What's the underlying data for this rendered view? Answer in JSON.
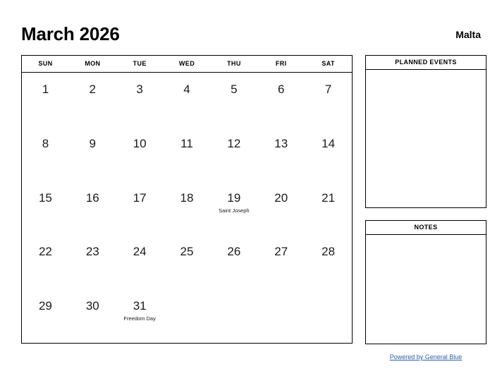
{
  "header": {
    "month_title": "March 2026",
    "location": "Malta"
  },
  "calendar": {
    "weekday_headers": [
      "SUN",
      "MON",
      "TUE",
      "WED",
      "THU",
      "FRI",
      "SAT"
    ],
    "weeks": [
      [
        {
          "day": "1",
          "event": ""
        },
        {
          "day": "2",
          "event": ""
        },
        {
          "day": "3",
          "event": ""
        },
        {
          "day": "4",
          "event": ""
        },
        {
          "day": "5",
          "event": ""
        },
        {
          "day": "6",
          "event": ""
        },
        {
          "day": "7",
          "event": ""
        }
      ],
      [
        {
          "day": "8",
          "event": ""
        },
        {
          "day": "9",
          "event": ""
        },
        {
          "day": "10",
          "event": ""
        },
        {
          "day": "11",
          "event": ""
        },
        {
          "day": "12",
          "event": ""
        },
        {
          "day": "13",
          "event": ""
        },
        {
          "day": "14",
          "event": ""
        }
      ],
      [
        {
          "day": "15",
          "event": ""
        },
        {
          "day": "16",
          "event": ""
        },
        {
          "day": "17",
          "event": ""
        },
        {
          "day": "18",
          "event": ""
        },
        {
          "day": "19",
          "event": "Saint Joseph"
        },
        {
          "day": "20",
          "event": ""
        },
        {
          "day": "21",
          "event": ""
        }
      ],
      [
        {
          "day": "22",
          "event": ""
        },
        {
          "day": "23",
          "event": ""
        },
        {
          "day": "24",
          "event": ""
        },
        {
          "day": "25",
          "event": ""
        },
        {
          "day": "26",
          "event": ""
        },
        {
          "day": "27",
          "event": ""
        },
        {
          "day": "28",
          "event": ""
        }
      ],
      [
        {
          "day": "29",
          "event": ""
        },
        {
          "day": "30",
          "event": ""
        },
        {
          "day": "31",
          "event": "Freedom Day"
        },
        {
          "day": "",
          "event": ""
        },
        {
          "day": "",
          "event": ""
        },
        {
          "day": "",
          "event": ""
        },
        {
          "day": "",
          "event": ""
        }
      ]
    ]
  },
  "panels": {
    "planned_events": {
      "title": "PLANNED EVENTS",
      "content": ""
    },
    "notes": {
      "title": "NOTES",
      "content": ""
    }
  },
  "footer": {
    "credit_text": "Powered by General Blue"
  },
  "colors": {
    "border": "#000000",
    "text": "#000000",
    "link": "#2a5db0",
    "background": "#ffffff"
  }
}
